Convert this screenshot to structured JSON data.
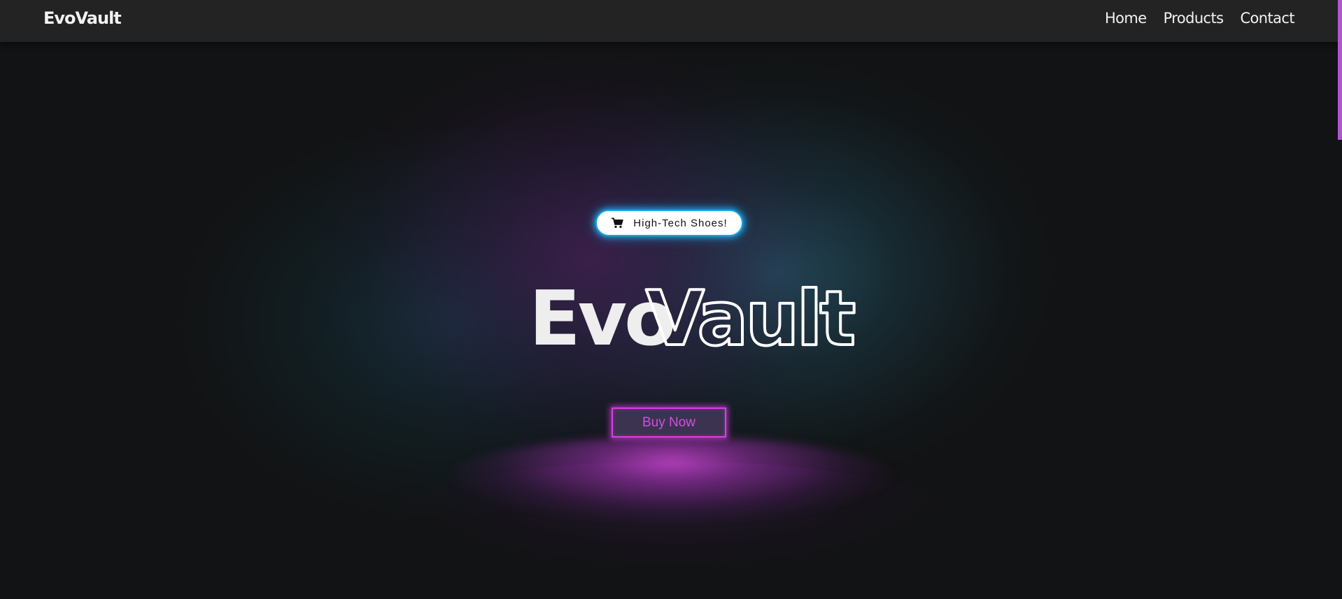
{
  "header": {
    "brand": "EvoVault",
    "nav": [
      {
        "label": "Home"
      },
      {
        "label": "Products"
      },
      {
        "label": "Contact"
      }
    ]
  },
  "hero": {
    "badge": {
      "icon": "shopping-cart-icon",
      "text": "High-Tech Shoes!",
      "border_color": "#19a8e0"
    },
    "title": {
      "solid_part": "Evo",
      "outline_part": "Vault"
    },
    "cta": {
      "label": "Buy Now",
      "accent_color": "#d63fe6"
    }
  },
  "colors": {
    "background": "#121314",
    "navbar": "#232323",
    "scrollbar_thumb": "#b455d0",
    "glow_teal": "#285f73",
    "glow_purple": "#461e55"
  }
}
